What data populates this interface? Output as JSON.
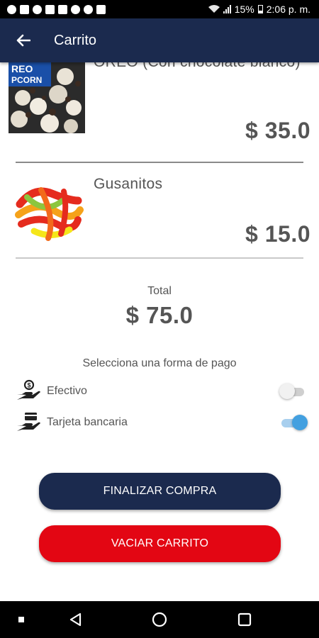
{
  "status_bar": {
    "time": "2:06 p. m.",
    "battery": "15%"
  },
  "app_bar": {
    "title": "Carrito",
    "back_icon": "arrow-left-icon"
  },
  "cart": {
    "items": [
      {
        "name": "OREO (Con chocolate blanco)",
        "price": "$ 35.0",
        "image": "oreo-popcorn-image"
      },
      {
        "name": "Gusanitos",
        "price": "$ 15.0",
        "image": "gummy-worms-image"
      }
    ],
    "partial_image_text": "REO\nPCORN"
  },
  "total": {
    "label": "Total",
    "value": "$ 75.0"
  },
  "payment": {
    "title": "Selecciona una forma de pago",
    "options": [
      {
        "label": "Efectivo",
        "icon": "cash-hand-icon",
        "enabled": false
      },
      {
        "label": "Tarjeta bancaria",
        "icon": "card-hand-icon",
        "enabled": true
      }
    ]
  },
  "actions": {
    "checkout_label": "FINALIZAR COMPRA",
    "clear_label": "VACIAR CARRITO"
  },
  "nav_bar": {
    "icons": [
      "recents-dot-icon",
      "back-triangle-icon",
      "home-circle-icon",
      "overview-square-icon"
    ]
  },
  "colors": {
    "primary": "#1b2a4e",
    "danger": "#e30613",
    "accent": "#43a0e0",
    "text": "#555555"
  }
}
